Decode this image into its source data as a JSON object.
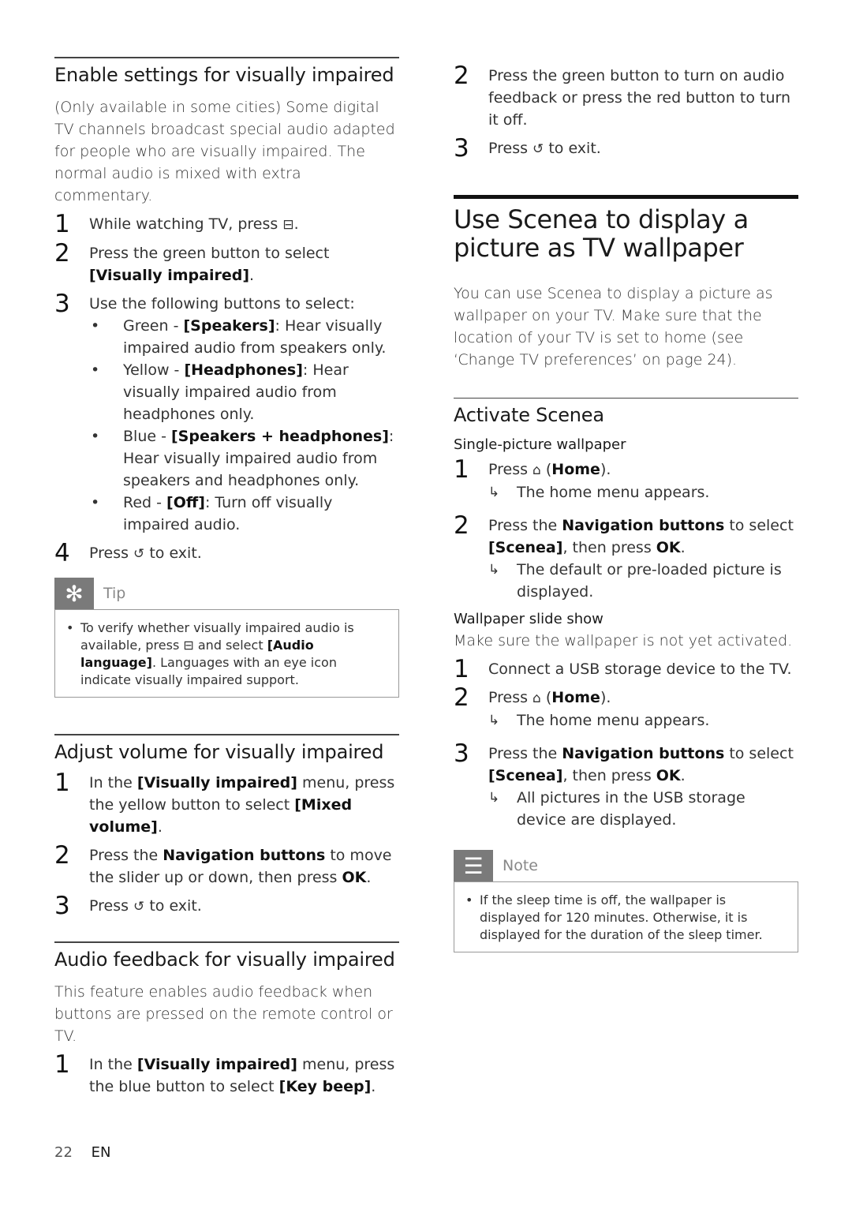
{
  "left": {
    "enable": {
      "title": "Enable settings for visually impaired",
      "intro": "(Only available in some cities) Some digital TV channels broadcast special audio adapted for people who are visually impaired. The normal audio is mixed with extra commentary.",
      "steps": [
        {
          "num": "1",
          "text": "While watching TV, press",
          "icon": "options-icon",
          "glyph": "⊟",
          "after": "."
        },
        {
          "num": "2",
          "pre": "Press the green button to select ",
          "bold": "[Visually impaired]",
          "post": "."
        },
        {
          "num": "3",
          "text": "Use the following buttons to select:"
        },
        {
          "num": "4",
          "pre": "Press ",
          "glyph": "↺",
          "post": " to exit."
        }
      ],
      "bullets": [
        {
          "pre": "Green - ",
          "bold": "[Speakers]",
          "post": ": Hear visually impaired audio from speakers only."
        },
        {
          "pre": "Yellow - ",
          "bold": "[Headphones]",
          "post": ": Hear visually impaired audio from headphones only."
        },
        {
          "pre": "Blue - ",
          "bold": "[Speakers + headphones]",
          "post": ": Hear visually impaired audio from speakers and headphones only."
        },
        {
          "pre": "Red - ",
          "bold": "[Off]",
          "post": ": Turn off visually impaired audio."
        }
      ]
    },
    "tip": {
      "label": "Tip",
      "glyph": "✻",
      "pre": "To verify whether visually impaired audio is available, press ",
      "glyph2": "⊟",
      "mid": " and select ",
      "bold": "[Audio language]",
      "post": ". Languages with an eye icon indicate visually impaired support."
    },
    "adjust": {
      "title": "Adjust volume for visually impaired",
      "steps": [
        {
          "num": "1",
          "pre": "In the ",
          "bold": "[Visually impaired]",
          "mid": " menu, press the yellow button to select ",
          "bold2": "[Mixed volume]",
          "post": "."
        },
        {
          "num": "2",
          "pre": "Press the ",
          "bold": "Navigation buttons",
          "mid": " to move the slider up or down, then press ",
          "bold2": "OK",
          "post": "."
        },
        {
          "num": "3",
          "pre": "Press ",
          "glyph": "↺",
          "post": " to exit."
        }
      ]
    },
    "feedback": {
      "title": "Audio feedback for visually impaired",
      "intro": "This feature enables audio feedback when buttons are pressed on the remote control or TV.",
      "steps": [
        {
          "num": "1",
          "pre": "In the ",
          "bold": "[Visually impaired]",
          "mid": " menu, press the blue button to select ",
          "bold2": "[Key beep]",
          "post": "."
        }
      ]
    }
  },
  "right": {
    "feedback_cont": [
      {
        "num": "2",
        "text": "Press the green button to turn on audio feedback or press the red button to turn it off."
      },
      {
        "num": "3",
        "pre": "Press ",
        "glyph": "↺",
        "post": " to exit."
      }
    ],
    "scenea": {
      "title": "Use Scenea to display a picture as TV wallpaper",
      "intro": "You can use Scenea to display a picture as wallpaper on your TV. Make sure that the location of your TV is set to home (see ‘Change TV preferences’ on page 24)."
    },
    "activate": {
      "title": "Activate Scenea",
      "single": {
        "heading": "Single-picture wallpaper",
        "steps": [
          {
            "num": "1",
            "pre": "Press ",
            "glyph": "⌂",
            "mid": " (",
            "bold": "Home",
            "post": ").",
            "result": "The home menu appears."
          },
          {
            "num": "2",
            "pre": "Press the ",
            "bold": "Navigation buttons",
            "mid": " to select ",
            "bold2": "[Scenea]",
            "mid2": ", then press ",
            "bold3": "OK",
            "post": ".",
            "result": "The default or pre-loaded picture is displayed."
          }
        ]
      },
      "slideshow": {
        "heading": "Wallpaper slide show",
        "intro": "Make sure the wallpaper is not yet activated.",
        "steps": [
          {
            "num": "1",
            "text": "Connect a USB storage device to the TV."
          },
          {
            "num": "2",
            "pre": "Press ",
            "glyph": "⌂",
            "mid": " (",
            "bold": "Home",
            "post": ").",
            "result": "The home menu appears."
          },
          {
            "num": "3",
            "pre": "Press the ",
            "bold": "Navigation buttons",
            "mid": " to select ",
            "bold2": "[Scenea]",
            "mid2": ", then press ",
            "bold3": "OK",
            "post": ".",
            "result": "All pictures in the USB storage device are displayed."
          }
        ]
      }
    },
    "note": {
      "label": "Note",
      "glyph": "☰",
      "text": "If the sleep time is off, the wallpaper is displayed for 120 minutes. Otherwise, it is displayed for the duration of the sleep timer."
    }
  },
  "footer": {
    "page": "22",
    "lang": "EN"
  },
  "common": {
    "bullet": "•",
    "arrow": "↳"
  }
}
